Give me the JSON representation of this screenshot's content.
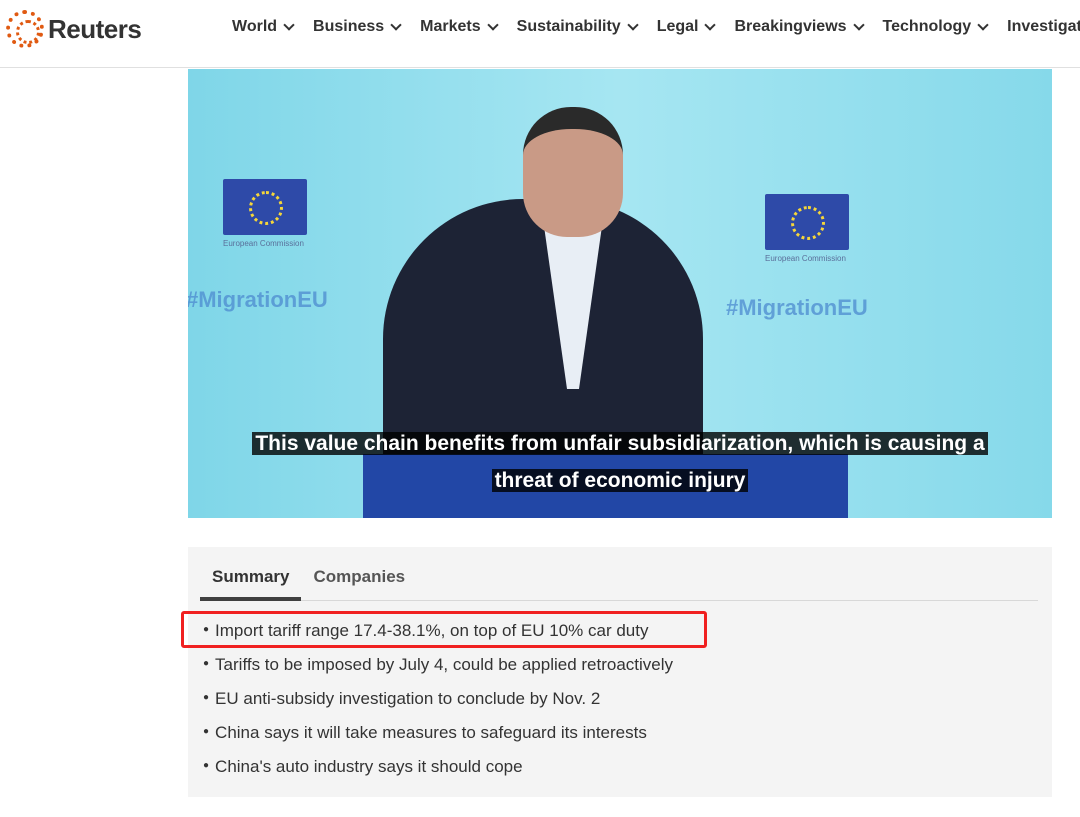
{
  "header": {
    "logo": "Reuters",
    "brand_color": "#e05a12",
    "nav": [
      {
        "label": "World"
      },
      {
        "label": "Business"
      },
      {
        "label": "Markets"
      },
      {
        "label": "Sustainability"
      },
      {
        "label": "Legal"
      },
      {
        "label": "Breakingviews"
      },
      {
        "label": "Technology"
      },
      {
        "label": "Investigations"
      }
    ]
  },
  "video": {
    "backdrop_text": "#MigrationEU",
    "backdrop_caption": "European Commission",
    "subtitle_line1": "This value chain benefits from unfair subsidiarization, which is causing a",
    "subtitle_line2": "threat of economic injury"
  },
  "summary": {
    "tabs": [
      {
        "label": "Summary",
        "active": true
      },
      {
        "label": "Companies",
        "active": false
      }
    ],
    "items": [
      "Import tariff range 17.4-38.1%, on top of EU 10% car duty",
      "Tariffs to be imposed by July 4, could be applied retroactively",
      "EU anti-subsidy investigation to conclude by Nov. 2",
      "China says it will take measures to safeguard its interests",
      "China's auto industry says it should cope"
    ],
    "highlight_color": "#f02020"
  }
}
